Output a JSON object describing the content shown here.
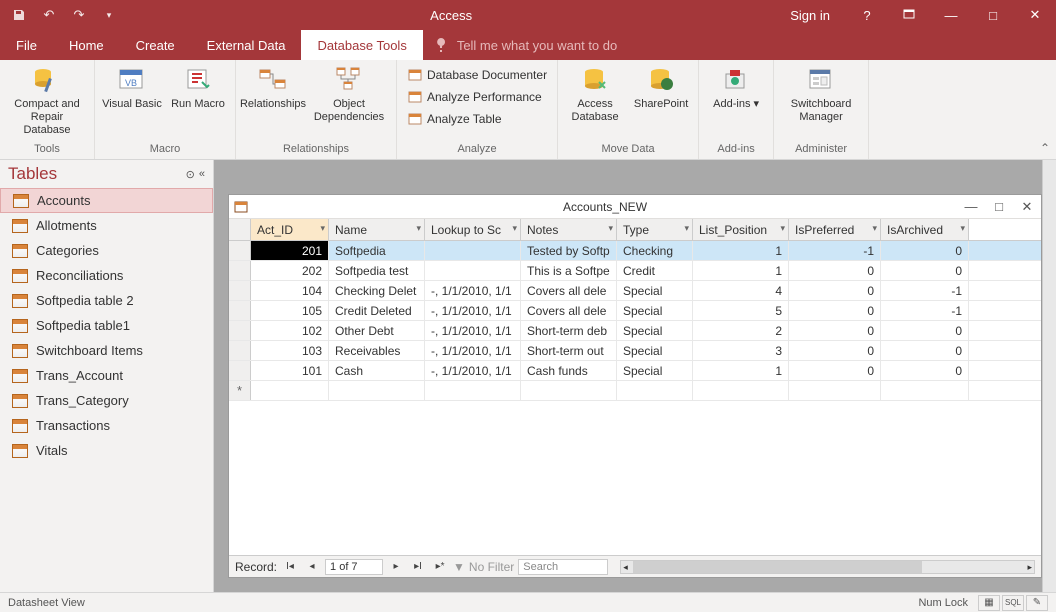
{
  "titlebar": {
    "app": "Access",
    "signin": "Sign in"
  },
  "tabs": {
    "items": [
      "File",
      "Home",
      "Create",
      "External Data",
      "Database Tools"
    ],
    "active": 4,
    "tellme": "Tell me what you want to do"
  },
  "ribbon": {
    "groups": [
      {
        "label": "Tools",
        "big": [
          {
            "name": "compact-repair",
            "text": "Compact and Repair Database"
          }
        ]
      },
      {
        "label": "Macro",
        "big": [
          {
            "name": "visual-basic",
            "text": "Visual Basic"
          },
          {
            "name": "run-macro",
            "text": "Run Macro"
          }
        ]
      },
      {
        "label": "Relationships",
        "big": [
          {
            "name": "relationships",
            "text": "Relationships"
          },
          {
            "name": "object-dependencies",
            "text": "Object Dependencies"
          }
        ]
      },
      {
        "label": "Analyze",
        "small": [
          {
            "name": "db-documenter",
            "text": "Database Documenter"
          },
          {
            "name": "analyze-perf",
            "text": "Analyze Performance"
          },
          {
            "name": "analyze-table",
            "text": "Analyze Table"
          }
        ]
      },
      {
        "label": "Move Data",
        "big": [
          {
            "name": "access-db",
            "text": "Access Database"
          },
          {
            "name": "sharepoint",
            "text": "SharePoint"
          }
        ]
      },
      {
        "label": "Add-ins",
        "big": [
          {
            "name": "addins",
            "text": "Add-ins ▾"
          }
        ]
      },
      {
        "label": "Administer",
        "big": [
          {
            "name": "switchboard",
            "text": "Switchboard Manager"
          }
        ]
      }
    ]
  },
  "nav": {
    "header": "Tables",
    "items": [
      "Accounts",
      "Allotments",
      "Categories",
      "Reconciliations",
      "Softpedia table 2",
      "Softpedia table1",
      "Switchboard Items",
      "Trans_Account",
      "Trans_Category",
      "Transactions",
      "Vitals"
    ],
    "selected": 0
  },
  "subwindow": {
    "title": "Accounts_NEW"
  },
  "grid": {
    "columns": [
      "Act_ID",
      "Name",
      "Lookup to Sc",
      "Notes",
      "Type",
      "List_Position",
      "IsPreferred",
      "IsArchived"
    ],
    "sorted_col": 0,
    "rows": [
      {
        "id": 201,
        "name": "Softpedia",
        "lookup": "",
        "notes": "Tested by Softp",
        "type": "Checking",
        "lp": 1,
        "pref": -1,
        "arch": 0
      },
      {
        "id": 202,
        "name": "Softpedia test",
        "lookup": "",
        "notes": "This is a Softpe",
        "type": "Credit",
        "lp": 1,
        "pref": 0,
        "arch": 0
      },
      {
        "id": 104,
        "name": "Checking Delet",
        "lookup": "-, 1/1/2010, 1/1",
        "notes": "Covers all dele",
        "type": "Special",
        "lp": 4,
        "pref": 0,
        "arch": -1
      },
      {
        "id": 105,
        "name": "Credit Deleted",
        "lookup": "-, 1/1/2010, 1/1",
        "notes": "Covers all dele",
        "type": "Special",
        "lp": 5,
        "pref": 0,
        "arch": -1
      },
      {
        "id": 102,
        "name": "Other Debt",
        "lookup": "-, 1/1/2010, 1/1",
        "notes": "Short-term deb",
        "type": "Special",
        "lp": 2,
        "pref": 0,
        "arch": 0
      },
      {
        "id": 103,
        "name": "Receivables",
        "lookup": "-, 1/1/2010, 1/1",
        "notes": "Short-term out",
        "type": "Special",
        "lp": 3,
        "pref": 0,
        "arch": 0
      },
      {
        "id": 101,
        "name": "Cash",
        "lookup": "-, 1/1/2010, 1/1",
        "notes": "Cash funds",
        "type": "Special",
        "lp": 1,
        "pref": 0,
        "arch": 0
      }
    ],
    "selected_row": 0
  },
  "recnav": {
    "label": "Record:",
    "counter": "1 of 7",
    "nofilter": "No Filter",
    "search": "Search"
  },
  "status": {
    "view": "Datasheet View",
    "numlock": "Num Lock"
  }
}
